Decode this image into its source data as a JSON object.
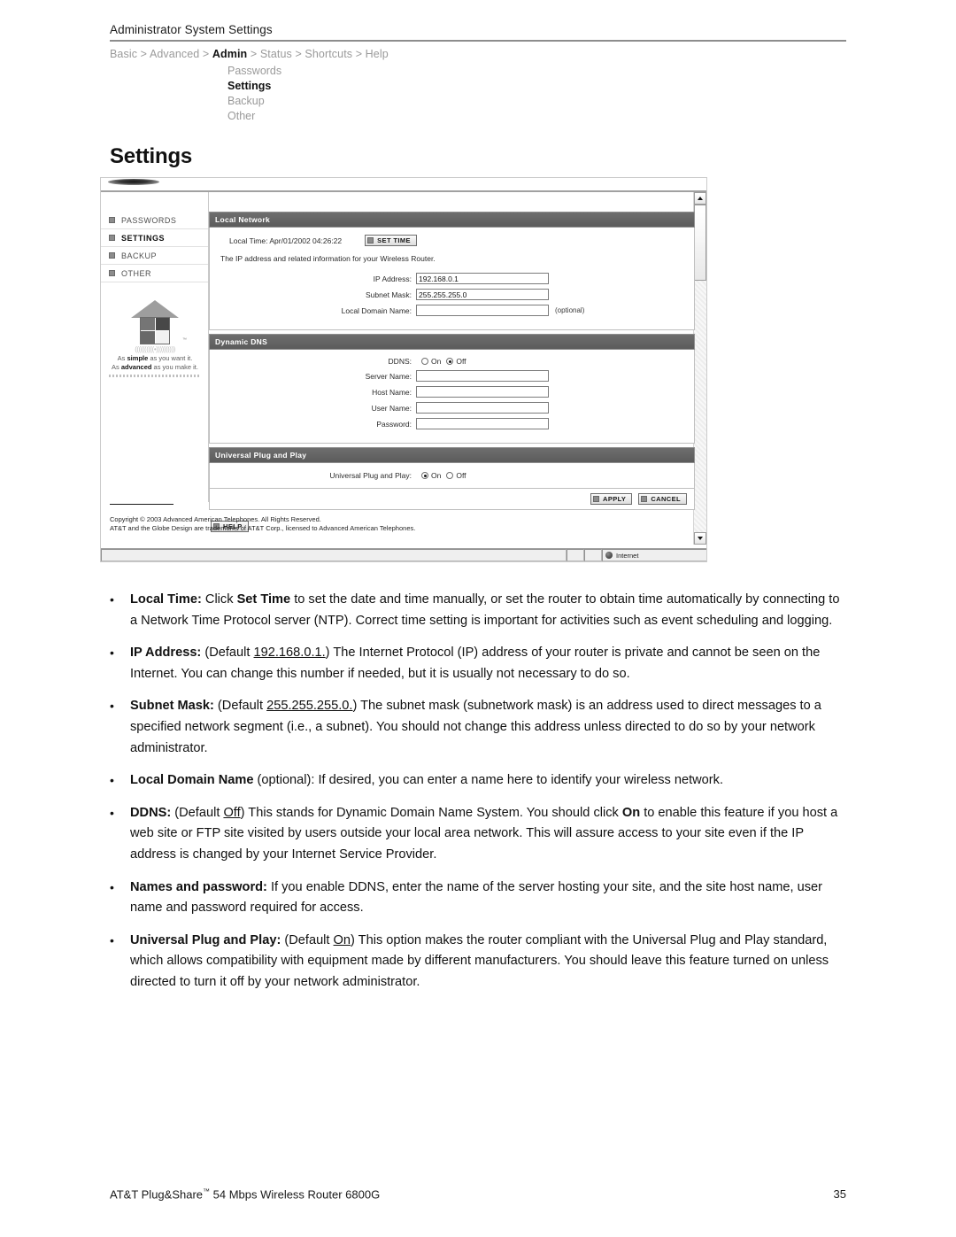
{
  "page": {
    "header_title": "Administrator System Settings",
    "section_title": "Settings",
    "footer_product": "AT&T Plug&Share",
    "footer_tm": "™",
    "footer_product_rest": " 54 Mbps Wireless Router 6800G",
    "page_number": "35"
  },
  "breadcrumb": {
    "items": [
      {
        "label": "Basic",
        "active": false
      },
      {
        "label": "Advanced",
        "active": false
      },
      {
        "label": "Admin",
        "active": true
      },
      {
        "label": "Status",
        "active": false
      },
      {
        "label": "Shortcuts",
        "active": false
      },
      {
        "label": "Help",
        "active": false
      }
    ],
    "separator": ">"
  },
  "subnav": {
    "items": [
      {
        "label": "Passwords",
        "active": false
      },
      {
        "label": "Settings",
        "active": true
      },
      {
        "label": "Backup",
        "active": false
      },
      {
        "label": "Other",
        "active": false
      }
    ]
  },
  "screenshot": {
    "sidebar": {
      "items": [
        {
          "label": "PASSWORDS",
          "active": false
        },
        {
          "label": "SETTINGS",
          "active": true
        },
        {
          "label": "BACKUP",
          "active": false
        },
        {
          "label": "OTHER",
          "active": false
        }
      ],
      "logo": {
        "waves": "((((((((((•))))))))))",
        "tagline_1_pre": "As ",
        "tagline_1_bold": "simple",
        "tagline_1_post": " as you want it.",
        "tagline_2_pre": "As ",
        "tagline_2_bold": "advanced",
        "tagline_2_post": " as you make it.",
        "tm": "™"
      }
    },
    "local_network": {
      "panel_title": "Local Network",
      "local_time_label": "Local Time:",
      "local_time_value": "Apr/01/2002 04:26:22",
      "set_time_button": "SET TIME",
      "description": "The IP address and related information for your Wireless Router.",
      "fields": [
        {
          "label": "IP Address:",
          "value": "192.168.0.1",
          "hint": ""
        },
        {
          "label": "Subnet Mask:",
          "value": "255.255.255.0",
          "hint": ""
        },
        {
          "label": "Local Domain Name:",
          "value": "",
          "hint": "(optional)"
        }
      ]
    },
    "dynamic_dns": {
      "panel_title": "Dynamic DNS",
      "ddns_label": "DDNS:",
      "on_label": "On",
      "off_label": "Off",
      "selected": "Off",
      "fields": [
        {
          "label": "Server Name:",
          "value": ""
        },
        {
          "label": "Host Name:",
          "value": ""
        },
        {
          "label": "User Name:",
          "value": ""
        },
        {
          "label": "Password:",
          "value": ""
        }
      ]
    },
    "upnp": {
      "panel_title": "Universal Plug and Play",
      "field_label": "Universal Plug and Play:",
      "on_label": "On",
      "off_label": "Off",
      "selected": "On"
    },
    "actions": {
      "apply_label": "APPLY",
      "cancel_label": "CANCEL",
      "help_label": "HELP"
    },
    "footer": {
      "copyright_line_1": "Copyright © 2003 Advanced American Telephones. All Rights Reserved.",
      "copyright_line_2": "AT&T and the Globe Design are trademarks of AT&T Corp., licensed to Advanced American Telephones."
    },
    "statusbar": {
      "message": "",
      "zone": "Internet"
    }
  },
  "bullets": [
    {
      "marker": "•",
      "html": "<b>Local Time:</b> Click <b>Set Time</b> to set the date and time manually, or set the router to obtain time automatically by connecting to a Network Time Protocol server (NTP). Correct time setting is important for activities such as event scheduling and logging."
    },
    {
      "marker": "•",
      "html": "<b>IP Address:</b> (Default <u>192.168.0.1.</u>) The Internet Protocol (IP) address of your router is private and cannot be seen on the Internet. You can change this number if needed, but it is usually not necessary to do so."
    },
    {
      "marker": "•",
      "html": "<b>Subnet Mask:</b> (Default <u>255.255.255.0.</u>) The subnet mask (subnetwork mask) is an address used to direct messages to a specified network segment (i.e., a subnet). You should not change this address unless directed to do so by your network administrator."
    },
    {
      "marker": "•",
      "html": "<b>Local Domain Name</b> (optional): If desired, you can enter a name here to identify your wireless network."
    },
    {
      "marker": "•",
      "html": "<b>DDNS:</b> (Default <u>Off</u>) This stands for Dynamic Domain Name System. You should click <b>On</b> to enable this feature if you host a web site or FTP site visited by users outside your local area network. This will assure access to your site even if the IP address is changed by your Internet Service Provider."
    },
    {
      "marker": "•",
      "html": "<b>Names and password:</b> If you enable DDNS, enter the name of the server hosting your site, and the site host name, user name and password required for access."
    },
    {
      "marker": "•",
      "html": "<b>Universal Plug and Play:</b> (Default <u>On</u>) This option makes the router compliant with the Universal Plug and Play standard, which allows compatibility with equipment made by different manufacturers. You should leave this feature turned on unless directed to turn it off by your network administrator."
    }
  ]
}
